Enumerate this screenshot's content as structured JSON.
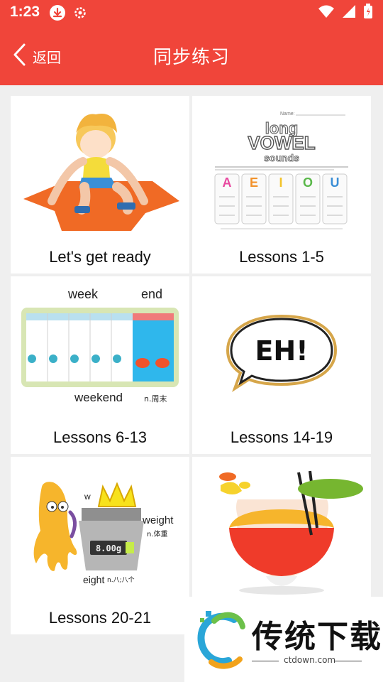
{
  "status": {
    "time": "1:23"
  },
  "header": {
    "back_label": "返回",
    "title": "同步练习"
  },
  "lessons": [
    {
      "label": "Let's get ready"
    },
    {
      "label": "Lessons 1-5",
      "image_text": {
        "name": "Name:",
        "top": "long",
        "main": "VOWEL",
        "bottom": "sounds",
        "letters": [
          "A",
          "E",
          "I",
          "O",
          "U"
        ]
      }
    },
    {
      "label": "Lessons 6-13",
      "image_text": {
        "word1": "week",
        "word2": "end",
        "compound": "weekend",
        "gloss": "n.周末"
      }
    },
    {
      "label": "Lessons 14-19",
      "image_text": {
        "bubble": "EH!"
      }
    },
    {
      "label": "Lessons 20-21",
      "image_text": {
        "w": "w",
        "weight": "weight",
        "weight_gloss": "n.体重",
        "eight": "eight",
        "eight_gloss": "n.八;八个",
        "scale": "8.00g"
      }
    },
    {
      "label": ""
    }
  ],
  "watermark": {
    "text": "传统下载",
    "url": "ctdown.com"
  }
}
